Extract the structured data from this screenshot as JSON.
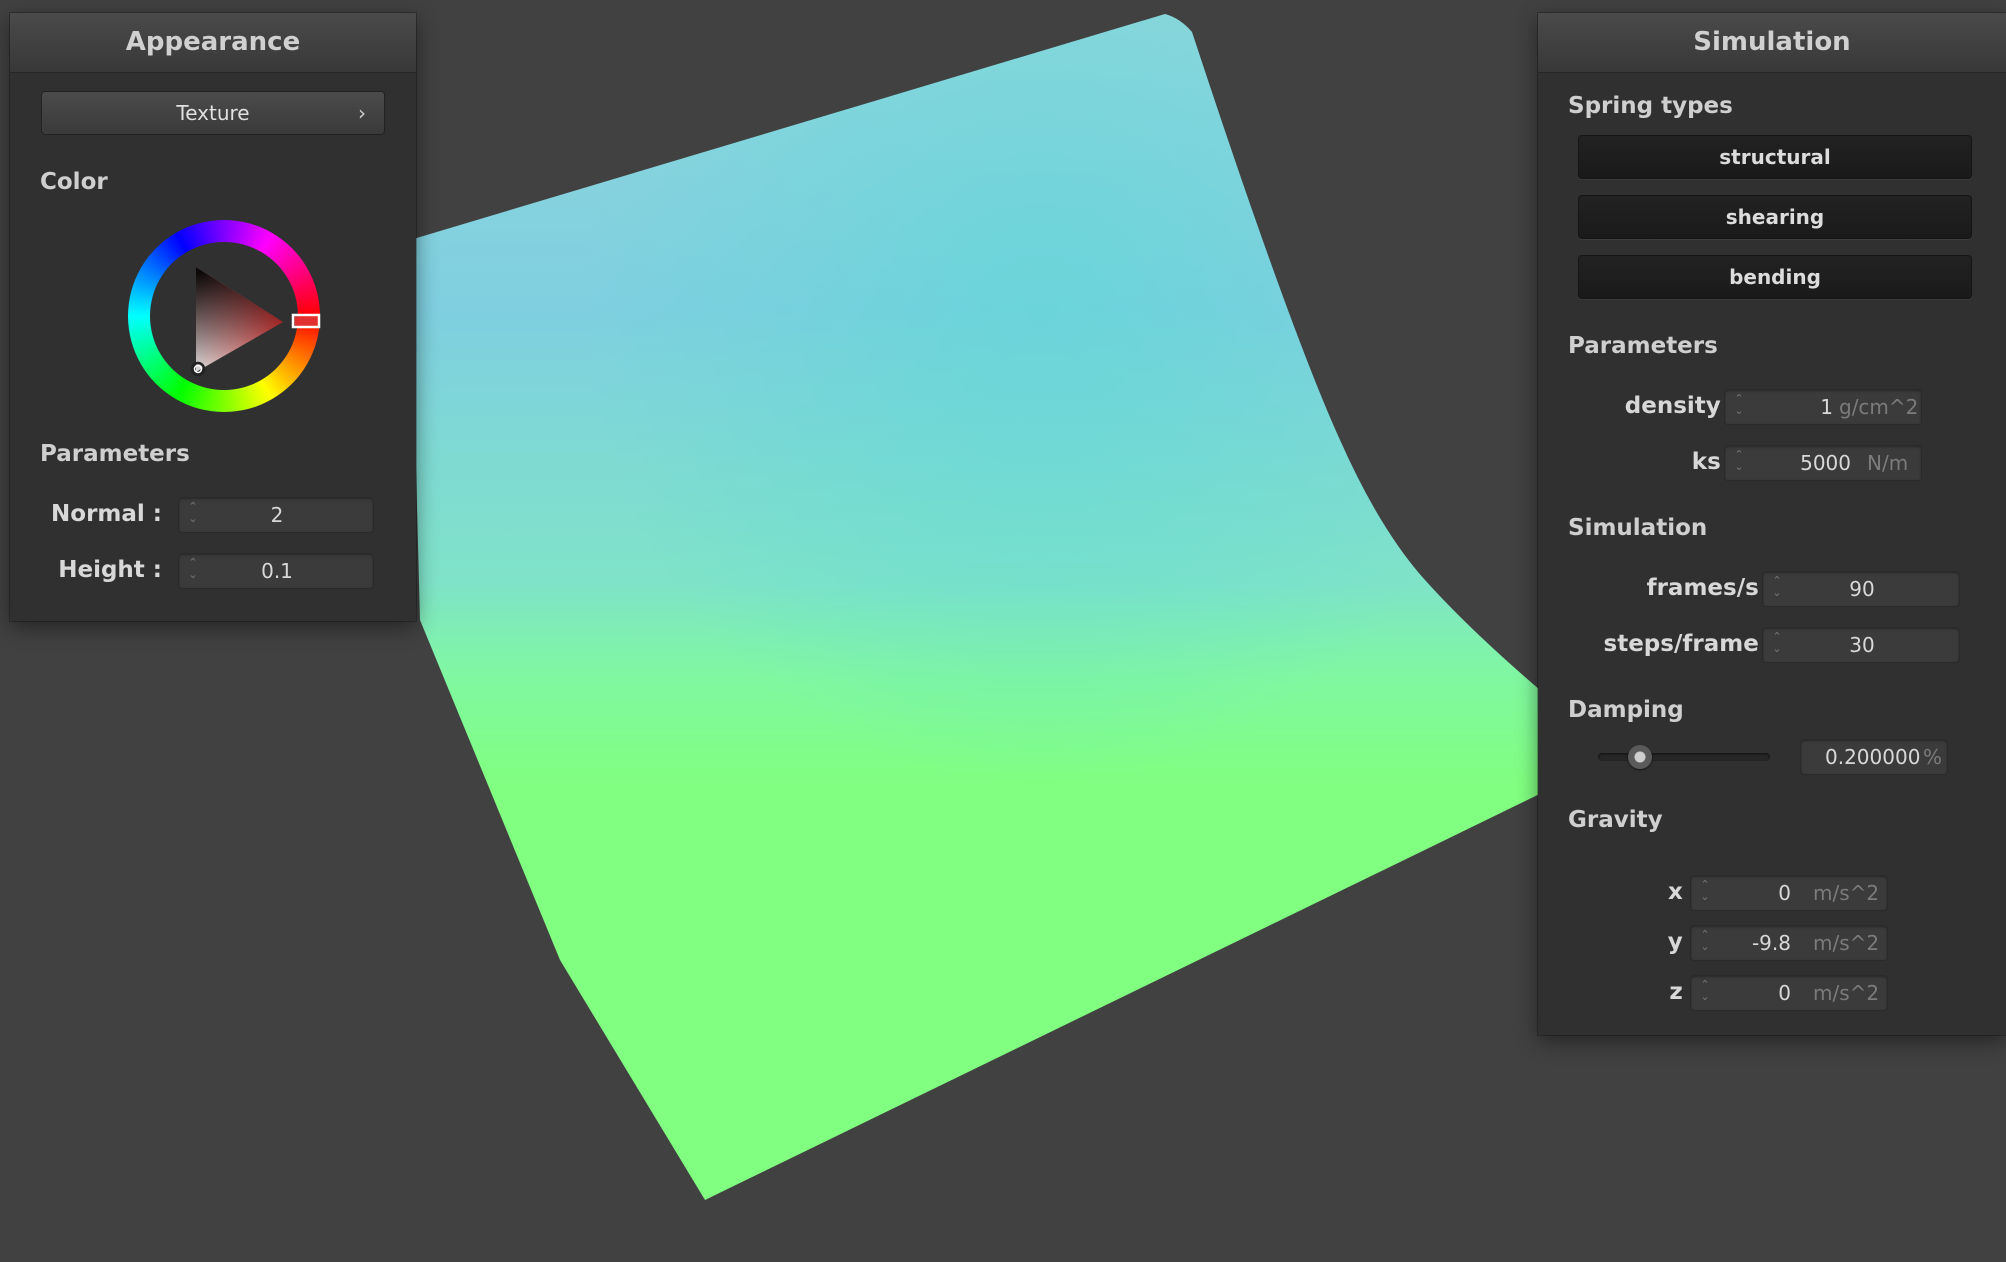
{
  "appearance_panel": {
    "title": "Appearance",
    "texture_button": {
      "label": "Texture",
      "chevron": "›"
    },
    "color_section": "Color",
    "parameters_section": "Parameters",
    "fields": [
      {
        "label": "Normal :",
        "value": "2"
      },
      {
        "label": "Height :",
        "value": "0.1"
      }
    ]
  },
  "simulation_panel": {
    "title": "Simulation",
    "spring_types_section": "Spring types",
    "spring_buttons": [
      "structural",
      "shearing",
      "bending"
    ],
    "parameters_section": "Parameters",
    "parameter_fields": [
      {
        "label": "density :",
        "value": "1",
        "unit": "g/cm^2"
      },
      {
        "label": "ks :",
        "value": "5000",
        "unit": "N/m"
      }
    ],
    "simulation_section": "Simulation",
    "simulation_fields": [
      {
        "label": "frames/s :",
        "value": "90"
      },
      {
        "label": "steps/frame :",
        "value": "30"
      }
    ],
    "damping_section": "Damping",
    "damping": {
      "value": "0.200000",
      "unit": "%",
      "slider_fraction": 0.2
    },
    "gravity_section": "Gravity",
    "gravity_fields": [
      {
        "label": "x :",
        "value": "0",
        "unit": "m/s^2"
      },
      {
        "label": "y :",
        "value": "-9.8",
        "unit": "m/s^2"
      },
      {
        "label": "z :",
        "value": "0",
        "unit": "m/s^2"
      }
    ]
  },
  "colors": {
    "background": "#414141",
    "panel": "#303030",
    "cloth_top": "#7ec8e3",
    "cloth_bottom": "#80ff80",
    "selected_color": "#e03030"
  },
  "icons": {
    "spinner": "spinner-icon",
    "chevron": "chevron-right-icon",
    "color_wheel": "color-wheel-icon"
  }
}
